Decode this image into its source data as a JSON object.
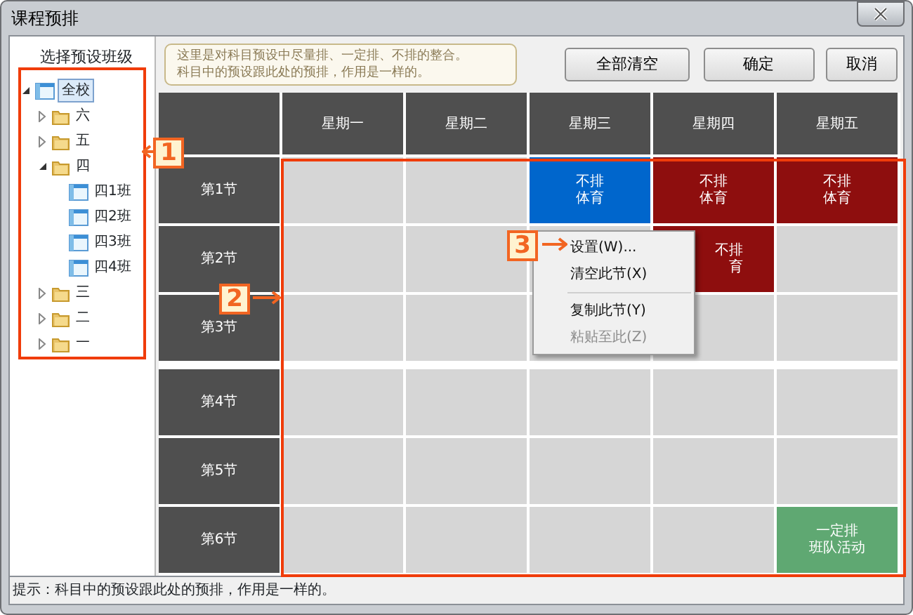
{
  "window": {
    "title": "课程预排"
  },
  "sidebar": {
    "title": "选择预设班级",
    "tree": [
      {
        "label": "全校",
        "selected": true,
        "expanded": true,
        "kind": "table",
        "children": [
          {
            "label": "六",
            "expanded": false,
            "kind": "folder",
            "selected": false
          },
          {
            "label": "五",
            "expanded": false,
            "kind": "folder",
            "selected": false
          },
          {
            "label": "四",
            "expanded": true,
            "kind": "folder",
            "selected": false,
            "children": [
              {
                "label": "四1班",
                "kind": "table",
                "selected": false
              },
              {
                "label": "四2班",
                "kind": "table",
                "selected": false
              },
              {
                "label": "四3班",
                "kind": "table",
                "selected": false
              },
              {
                "label": "四4班",
                "kind": "table",
                "selected": false
              }
            ]
          },
          {
            "label": "三",
            "expanded": false,
            "kind": "folder",
            "selected": false
          },
          {
            "label": "二",
            "expanded": false,
            "kind": "folder",
            "selected": false
          },
          {
            "label": "一",
            "expanded": false,
            "kind": "folder",
            "selected": false
          }
        ]
      }
    ]
  },
  "note": [
    "这里是对科目预设中尽量排、一定排、不排的整合。",
    "科目中的预设跟此处的预排，作用是一样的。"
  ],
  "buttons": [
    {
      "label": "全部清空"
    },
    {
      "label": "确定"
    },
    {
      "label": "取消"
    }
  ],
  "schedule": {
    "columns": [
      "星期一",
      "星期二",
      "星期三",
      "星期四",
      "星期五"
    ],
    "rows": [
      {
        "label": "第1节",
        "cells": [
          null,
          null,
          {
            "lines": [
              "不排",
              "体育"
            ],
            "color": "#0066cc"
          },
          {
            "lines": [
              "不排",
              "体育"
            ],
            "color": "#8e0e0e"
          },
          {
            "lines": [
              "不排",
              "体育"
            ],
            "color": "#8e0e0e"
          }
        ]
      },
      {
        "label": "第2节",
        "cells": [
          null,
          null,
          null,
          {
            "lines": [
              "不排",
              "育"
            ],
            "color": "#8e0e0e"
          },
          null
        ]
      },
      {
        "label": "第3节",
        "cells": [
          null,
          null,
          null,
          null,
          null
        ]
      },
      {
        "label": "第4节",
        "cells": [
          null,
          null,
          null,
          null,
          null
        ]
      },
      {
        "label": "第5节",
        "cells": [
          null,
          null,
          null,
          null,
          null
        ]
      },
      {
        "label": "第6节",
        "cells": [
          null,
          null,
          null,
          null,
          {
            "lines": [
              "一定排",
              "班队活动"
            ],
            "color": "#5fa872"
          }
        ]
      }
    ]
  },
  "context_menu": [
    {
      "label": "设置(W)...",
      "disabled": false
    },
    {
      "label": "清空此节(X)",
      "disabled": false
    },
    {
      "kind": "separator"
    },
    {
      "label": "复制此节(Y)",
      "disabled": false
    },
    {
      "label": "粘贴至此(Z)",
      "disabled": true
    }
  ],
  "status_bar": "提示：科目中的预设跟此处的预排，作用是一样的。",
  "annotations": [
    "1",
    "2",
    "3"
  ]
}
